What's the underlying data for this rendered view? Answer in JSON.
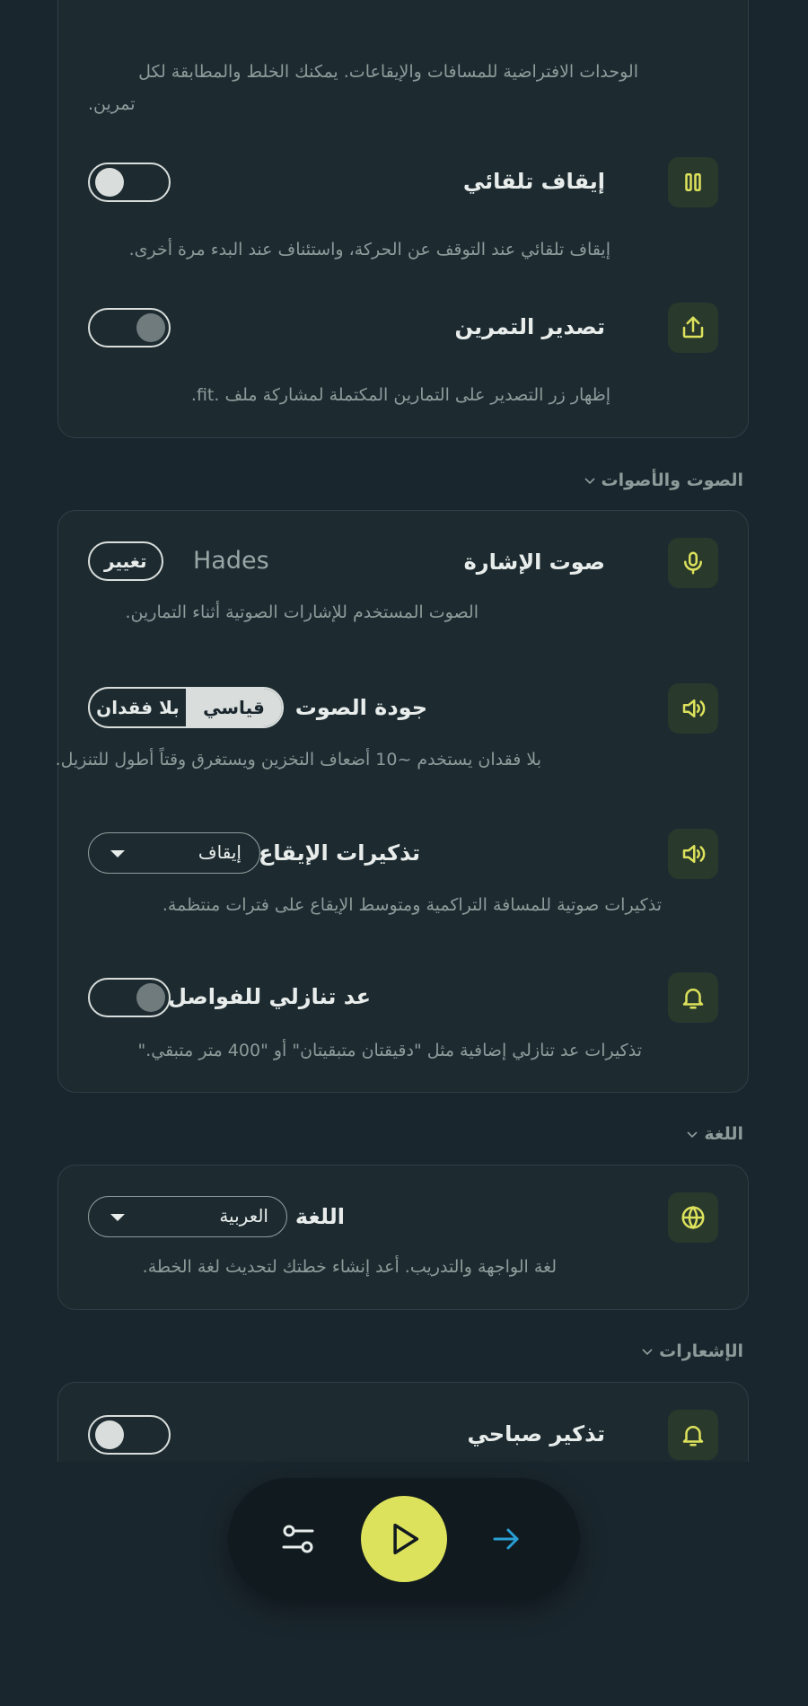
{
  "colors": {
    "accent": "#dde25c",
    "arrow": "#2a9fd6",
    "background": "#1a262d",
    "card": "#1d2b31"
  },
  "workout_card": {
    "intro_line1": "الوحدات الافتراضية للمسافات والإيقاعات. يمكنك الخلط والمطابقة لكل",
    "intro_line2": "تمرين.",
    "auto_pause": {
      "title": "إيقاف تلقائي",
      "desc": "إيقاف تلقائي عند التوقف عن الحركة، واستئناف عند البدء مرة أخرى.",
      "enabled": false,
      "icon": "pause-icon"
    },
    "export": {
      "title": "تصدير التمرين",
      "desc": "إظهار زر التصدير على التمارين المكتملة لمشاركة ملف .fit.",
      "enabled": true,
      "icon": "share-icon"
    }
  },
  "audio_section": {
    "heading": "الصوت والأصوات",
    "cue_voice": {
      "title": "صوت الإشارة",
      "value": "Hades",
      "button": "تغيير",
      "desc": "الصوت المستخدم للإشارات الصوتية أثناء التمارين.",
      "icon": "microphone-icon"
    },
    "audio_quality": {
      "title": "جودة الصوت",
      "option_standard": "قياسي",
      "option_lossless": "بلا فقدان",
      "selected": "قياسي",
      "desc": "بلا فقدان يستخدم ~10 أضعاف التخزين ويستغرق وقتاً أطول للتنزيل.",
      "icon": "speaker-icon"
    },
    "pace_reminders": {
      "title": "تذكيرات الإيقاع",
      "value": "إيقاف",
      "desc": "تذكيرات صوتية للمسافة التراكمية ومتوسط الإيقاع على فترات منتظمة.",
      "icon": "speaker-icon"
    },
    "interval_countdown": {
      "title": "عد تنازلي للفواصل",
      "desc": "تذكيرات عد تنازلي إضافية مثل \"دقيقتان متبقيتان\" أو \"400 متر متبقي.\"",
      "enabled": true,
      "icon": "bell-icon"
    }
  },
  "language_section": {
    "heading": "اللغة",
    "language": {
      "title": "اللغة",
      "value": "العربية",
      "desc": "لغة الواجهة والتدريب. أعد إنشاء خطتك لتحديث لغة الخطة.",
      "icon": "globe-icon"
    }
  },
  "notifications_section": {
    "heading": "الإشعارات",
    "morning_reminder": {
      "title": "تذكير صباحي",
      "enabled": false,
      "icon": "bell-icon"
    }
  },
  "bottom_bar": {
    "left_icon": "sliders-icon",
    "center_icon": "play-icon",
    "right_icon": "arrow-right-icon"
  }
}
